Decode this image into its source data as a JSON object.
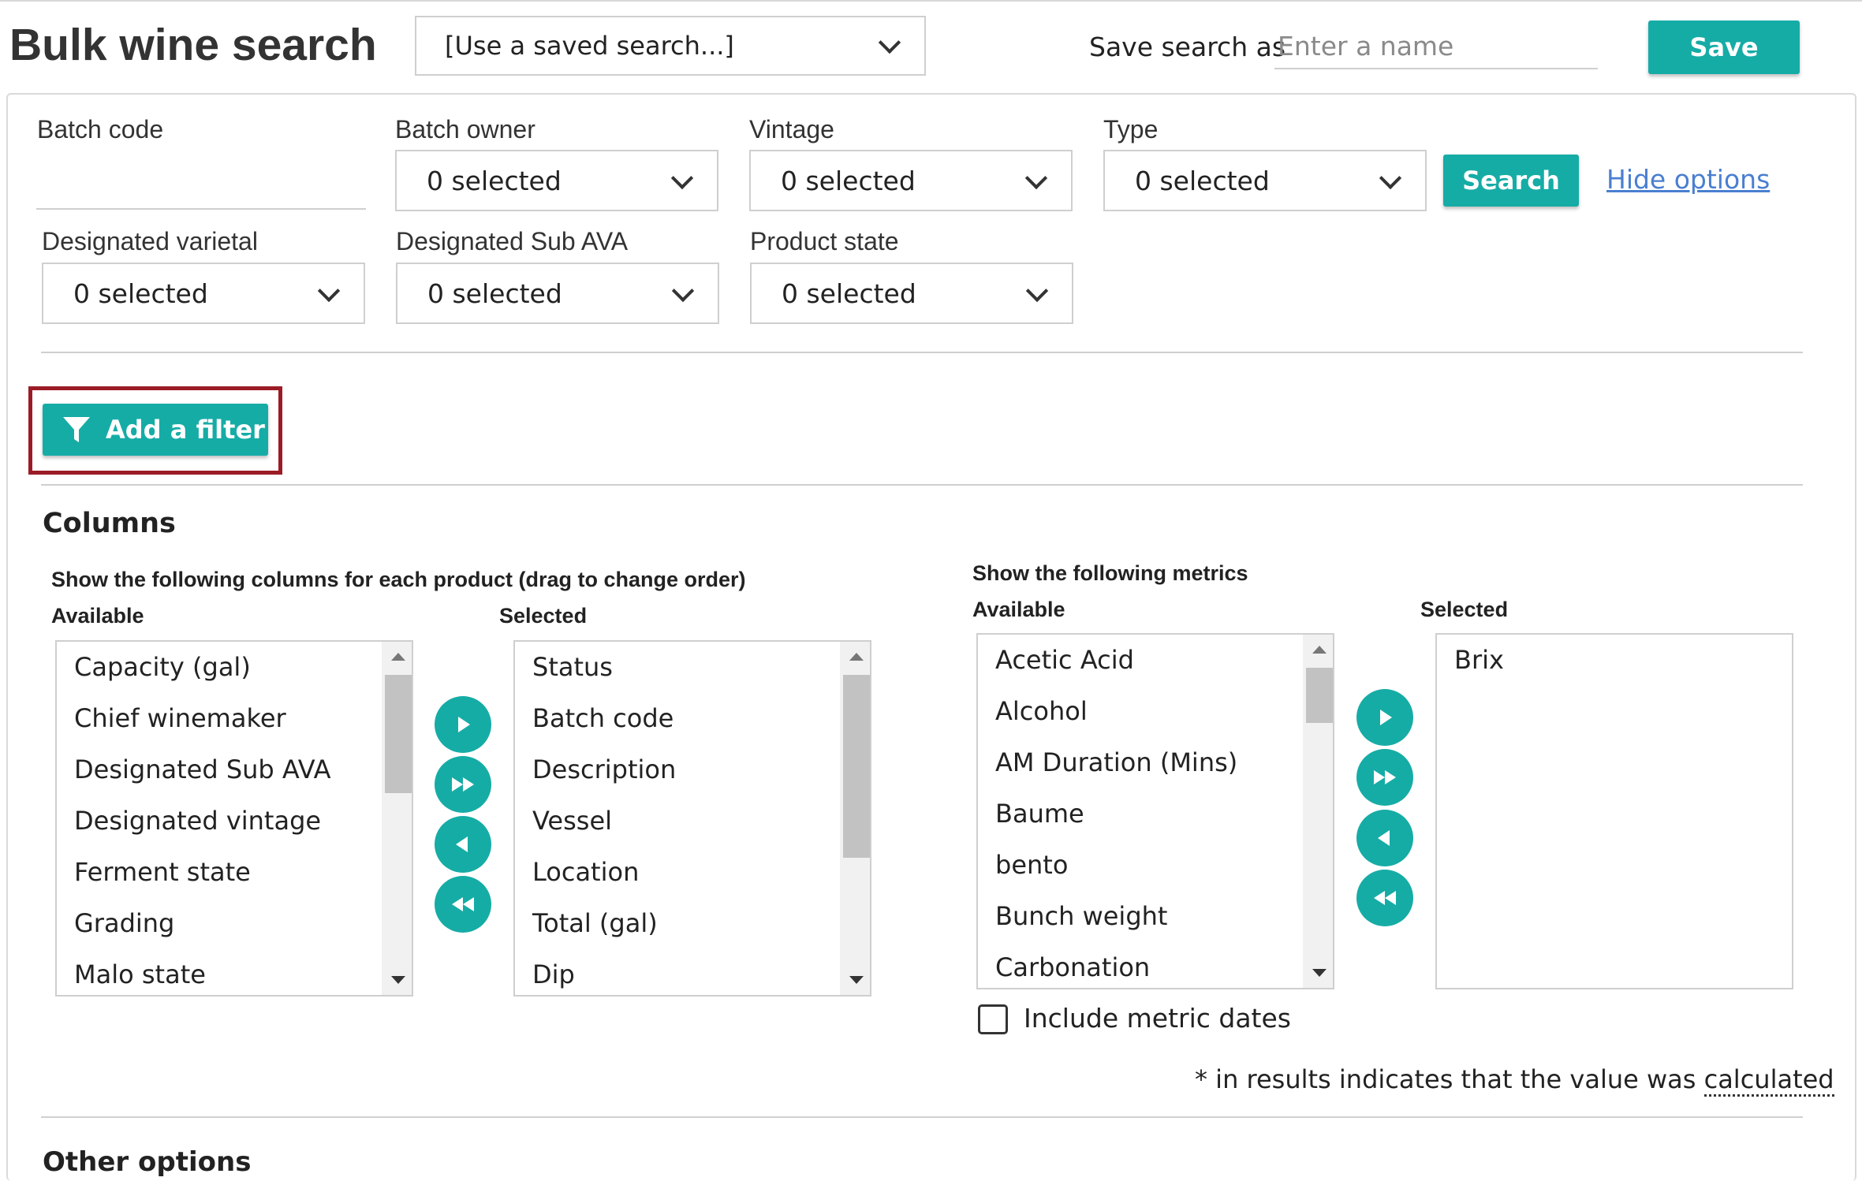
{
  "header": {
    "title": "Bulk wine search",
    "saved_search": "[Use a saved search...]",
    "save_as_label": "Save search as",
    "save_name_placeholder": "Enter a name",
    "save_label": "Save"
  },
  "filters": {
    "batch_code": {
      "label": "Batch code",
      "value": ""
    },
    "batch_owner": {
      "label": "Batch owner",
      "value": "0 selected"
    },
    "vintage": {
      "label": "Vintage",
      "value": "0 selected"
    },
    "type": {
      "label": "Type",
      "value": "0 selected"
    },
    "designated_varietal": {
      "label": "Designated varietal",
      "value": "0 selected"
    },
    "designated_sub_ava": {
      "label": "Designated Sub AVA",
      "value": "0 selected"
    },
    "product_state": {
      "label": "Product state",
      "value": "0 selected"
    },
    "search_label": "Search",
    "hide_options_label": "Hide options",
    "add_filter_label": "Add a filter"
  },
  "columns": {
    "title": "Columns",
    "instructions": "Show the following columns for each product (drag to change order)",
    "available_label": "Available",
    "selected_label": "Selected",
    "available": [
      "Capacity (gal)",
      "Chief winemaker",
      "Designated Sub AVA",
      "Designated vintage",
      "Ferment state",
      "Grading",
      "Malo state"
    ],
    "selected": [
      "Status",
      "Batch code",
      "Description",
      "Vessel",
      "Location",
      "Total (gal)",
      "Dip"
    ]
  },
  "metrics": {
    "instructions": "Show the following metrics",
    "available_label": "Available",
    "selected_label": "Selected",
    "available": [
      "Acetic Acid",
      "Alcohol",
      "AM Duration (Mins)",
      "Baume",
      "bento",
      "Bunch weight",
      "Carbonation"
    ],
    "selected": [
      "Brix"
    ],
    "include_dates_label": "Include metric dates",
    "include_dates_checked": false
  },
  "calc_note": {
    "prefix": "* in results indicates that the value was ",
    "link": "calculated"
  },
  "other_options_title": "Other options",
  "colors": {
    "accent": "#16aca6",
    "highlight": "#9b1c26",
    "link": "#4a7fd0"
  }
}
